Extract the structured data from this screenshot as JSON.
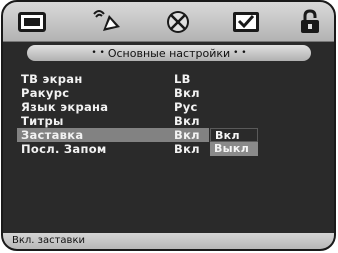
{
  "tabs": [
    {
      "icon": "screen-icon"
    },
    {
      "icon": "audio-icon"
    },
    {
      "icon": "disc-icon"
    },
    {
      "icon": "check-icon"
    },
    {
      "icon": "lock-icon"
    }
  ],
  "header": {
    "title": "Основные настройки",
    "dots_left": "• •",
    "dots_right": "• •"
  },
  "menu": {
    "items": [
      {
        "label": "ТВ экран",
        "value": "LB"
      },
      {
        "label": "Ракурс",
        "value": "Вкл"
      },
      {
        "label": "Язык экрана",
        "value": "Рус"
      },
      {
        "label": "Титры",
        "value": "Вкл"
      },
      {
        "label": "Заставка",
        "value": "Вкл"
      },
      {
        "label": "Посл. Запом",
        "value": "Вкл"
      }
    ],
    "submenu": [
      {
        "label": "Вкл"
      },
      {
        "label": "Выкл"
      }
    ]
  },
  "status": {
    "text": "Вкл. заставки"
  },
  "colors": {
    "background": "#2a2a2a",
    "highlight": "#828282",
    "bar": "#c8c8c8"
  }
}
